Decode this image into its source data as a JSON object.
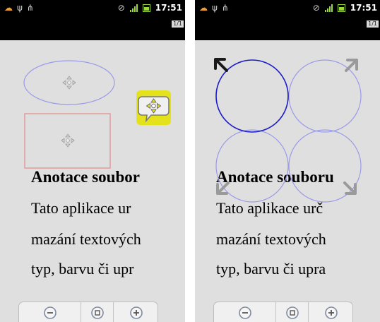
{
  "status_bar": {
    "time": "17:51",
    "page_indicator": "1/1"
  },
  "colors": {
    "background": "#dfdfdf",
    "shape_stroke": "#9a9ae8",
    "selected_stroke": "#1c1cc8",
    "rect_stroke": "#e08a8a",
    "tool_bg": "#e4e21b"
  },
  "document": {
    "left": {
      "heading": "Anotace soubor",
      "lines": [
        "Tato aplikace ur",
        "mazání textových",
        "typ, barvu či upr"
      ]
    },
    "right": {
      "heading": "Anotace souboru",
      "lines": [
        "Tato aplikace urč",
        "mazání textových",
        "typ, barvu či upra"
      ]
    }
  },
  "icons": {
    "move_handle": "move-arrows-icon",
    "resize_handle": "resize-arrow-icon",
    "annotation_tool": "speech-bubble-move-icon",
    "zoom_out": "zoom-out-icon",
    "zoom_fit": "zoom-fit-icon",
    "zoom_in": "zoom-in-icon"
  }
}
